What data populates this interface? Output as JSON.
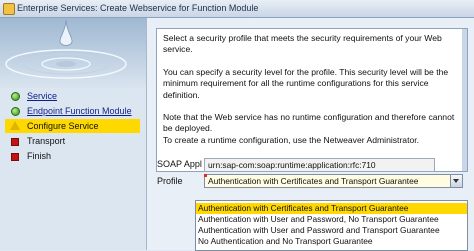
{
  "window": {
    "title": "Enterprise Services: Create Webservice for Function Module"
  },
  "sidebar": {
    "steps": [
      {
        "label": "Service",
        "status": "done",
        "link": true
      },
      {
        "label": "Endpoint Function Module",
        "status": "done",
        "link": true
      },
      {
        "label": "Configure Service",
        "status": "current",
        "link": false
      },
      {
        "label": "Transport",
        "status": "pending",
        "link": false
      },
      {
        "label": "Finish",
        "status": "pending",
        "link": false
      }
    ]
  },
  "info": {
    "paragraphs": [
      "Select a security profile that meets the security requirements of your Web service.",
      "You can specify a security level for the profile. This security level will be the minimum requirement for all the runtime configurations for this service definition.",
      "Note that the Web service has no runtime configuration and therefore cannot be deployed.",
      "To create a runtime configuration, use the Netweaver Administrator."
    ]
  },
  "form": {
    "soap_label": "SOAP Appl",
    "soap_value": "urn:sap-com:soap:runtime:application:rfc:710",
    "profile_label": "Profile",
    "profile_value": "Authentication with Certificates and Transport Guarantee",
    "profile_options": [
      "Authentication with Certificates and Transport Guarantee",
      "Authentication with User and Password, No Transport Guarantee",
      "Authentication with User and Password and Transport Guarantee",
      "No Authentication and No Transport Guarantee"
    ]
  },
  "colors": {
    "highlight": "#ffd800",
    "done": "#2f8d1d",
    "pending": "#c31414",
    "current": "#e0b400"
  }
}
